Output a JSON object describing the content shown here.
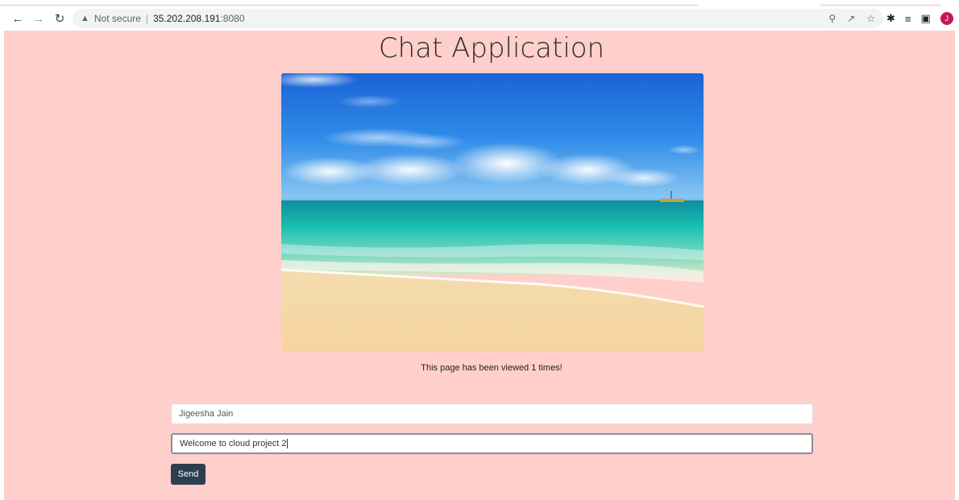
{
  "browser": {
    "security_label": "Not secure",
    "separator": "|",
    "url_host": "35.202.208.191",
    "url_port": ":8080",
    "avatar_letter": "J",
    "icons": [
      "back-arrow-icon",
      "forward-arrow-icon",
      "reload-icon",
      "warning-icon",
      "zoom-icon",
      "share-icon",
      "star-icon",
      "extensions-icon",
      "reading-list-icon",
      "side-panel-icon"
    ]
  },
  "page": {
    "title": "Chat Application",
    "views_text": "This page has been viewed 1 times!",
    "name_value": "Jigeesha Jain",
    "message_value": "Welcome to cloud project 2",
    "send_label": "Send",
    "background": "#ffcfcb",
    "button_color": "#2c3e50"
  }
}
